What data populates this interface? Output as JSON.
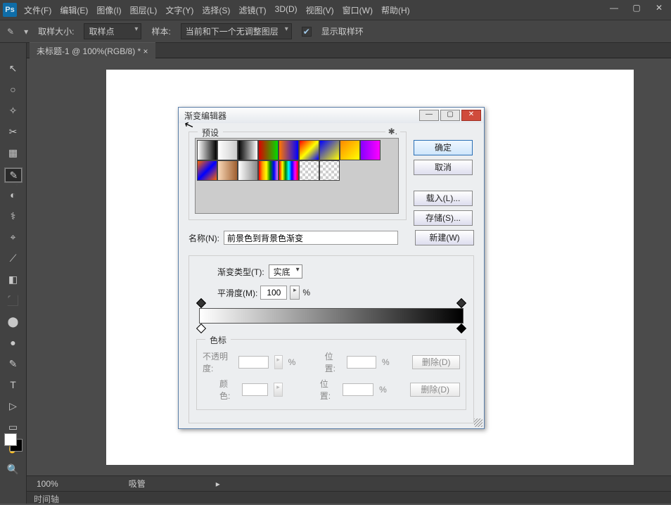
{
  "menu": {
    "file": "文件(F)",
    "edit": "编辑(E)",
    "image": "图像(I)",
    "layer": "图层(L)",
    "type": "文字(Y)",
    "select": "选择(S)",
    "filter": "滤镜(T)",
    "threeD": "3D(D)",
    "view": "视图(V)",
    "window": "窗口(W)",
    "help": "帮助(H)"
  },
  "opt": {
    "sample_size_label": "取样大小:",
    "sample_size_value": "取样点",
    "sample_label": "样本:",
    "sample_value": "当前和下一个无调整图层",
    "show_circle": "显示取样环"
  },
  "doc_tab": "未标题-1 @ 100%(RGB/8) * ×",
  "status": {
    "zoom": "100%",
    "tool": "吸管"
  },
  "timeline": "时间轴",
  "dlg": {
    "title": "渐变编辑器",
    "presets_label": "预设",
    "btn_ok": "确定",
    "btn_cancel": "取消",
    "btn_load": "载入(L)...",
    "btn_save": "存储(S)...",
    "btn_new": "新建(W)",
    "name_label": "名称(N):",
    "name_value": "前景色到背景色渐变",
    "grad_type_label": "渐变类型(T):",
    "grad_type_value": "实底",
    "smooth_label": "平滑度(M):",
    "smooth_value": "100",
    "percent": "%",
    "stops_label": "色标",
    "opacity_label": "不透明度:",
    "loc_label": "位置:",
    "color_label": "颜色:",
    "delete_label": "删除(D)"
  },
  "presets": [
    "linear-gradient(90deg,#fff,#000)",
    "linear-gradient(90deg,#fff,transparent)",
    "linear-gradient(90deg,#000,#fff)",
    "linear-gradient(90deg,#d00,#0d0)",
    "linear-gradient(90deg,#f70,#00f)",
    "linear-gradient(135deg,#f00,#ff0,#00f)",
    "linear-gradient(135deg,#00f,#ff0)",
    "linear-gradient(135deg,#f80,#ff0)",
    "linear-gradient(90deg,#80f,#f0f)",
    "linear-gradient(135deg,#f60,#00f,#f60)",
    "linear-gradient(90deg,#f8d8b8,#a06030)",
    "linear-gradient(90deg,#fff,#888)",
    "linear-gradient(90deg,red,orange,yellow,green,blue,violet)",
    "linear-gradient(90deg,red,yellow,green,cyan,blue,magenta,red)",
    "repeating-conic-gradient(#ccc 0 25%,#fff 0 50%) 0/8px 8px",
    "repeating-conic-gradient(#ccc 0 25%,#fff 0 50%) 0/8px 8px"
  ],
  "tools": [
    "↖",
    "○",
    "✧",
    "✂",
    "▦",
    "✎",
    "◐",
    "⚕",
    "⌖",
    "⟋",
    "◧",
    "⬛",
    "⬤",
    "●",
    "✎",
    "T",
    "▷",
    "▭",
    "✋",
    "🔍"
  ]
}
